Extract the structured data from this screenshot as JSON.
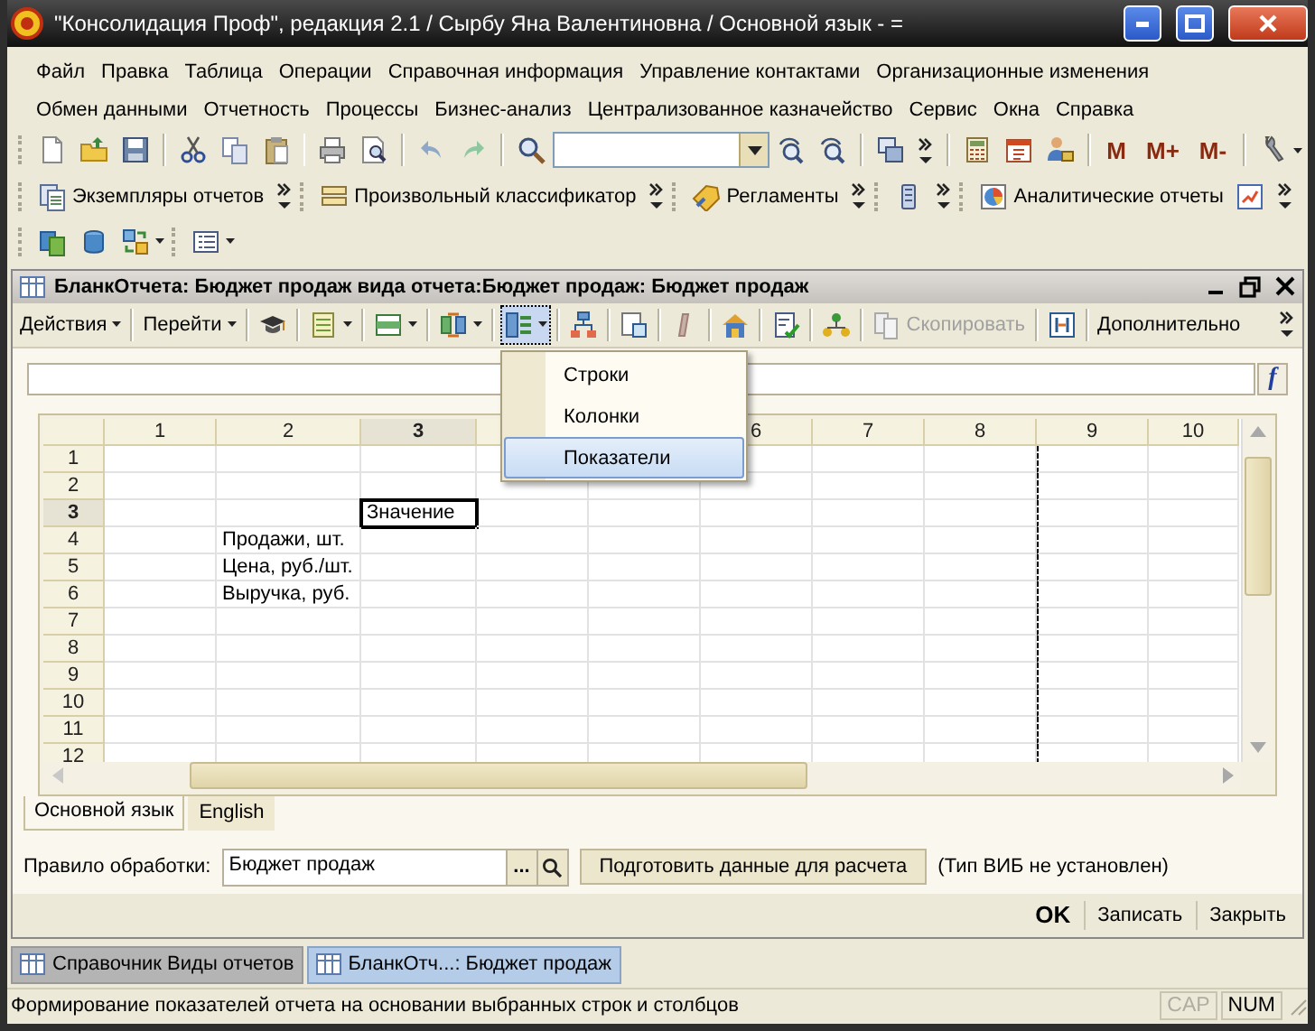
{
  "window": {
    "title": "\"Консолидация Проф\", редакция 2.1 / Сырбу Яна Валентиновна / Основной язык - ="
  },
  "menu_rows": [
    [
      "Файл",
      "Правка",
      "Таблица",
      "Операции",
      "Справочная информация",
      "Управление контактами",
      "Организационные изменения"
    ],
    [
      "Обмен данными",
      "Отчетность",
      "Процессы",
      "Бизнес-анализ",
      "Централизованное казначейство",
      "Сервис",
      "Окна",
      "Справка"
    ]
  ],
  "toolbar_1": {
    "memory_buttons": [
      "M",
      "M+",
      "M-"
    ]
  },
  "toolbar_2": {
    "buttons": [
      "Экземпляры отчетов",
      "Произвольный классификатор",
      "Регламенты",
      "Аналитические отчеты"
    ]
  },
  "document_window": {
    "title": "БланкОтчета: Бюджет продаж вида отчета:Бюджет продаж: Бюджет продаж",
    "toolbar": {
      "actions_menu": "Действия",
      "go_menu": "Перейти",
      "copy_button": {
        "label": "Скопировать",
        "disabled": true
      },
      "more_button": "Дополнительно"
    },
    "dropdown": {
      "open": true,
      "items": [
        {
          "label": "Строки",
          "selected": false
        },
        {
          "label": "Колонки",
          "selected": false
        },
        {
          "label": "Показатели",
          "selected": true
        }
      ]
    },
    "formula_button": "f",
    "table": {
      "columns": [
        {
          "label": "1",
          "selected": false
        },
        {
          "label": "2",
          "selected": false
        },
        {
          "label": "3",
          "selected": true
        },
        {},
        {},
        {
          "label": "6",
          "selected": false
        },
        {
          "label": "7",
          "selected": false
        },
        {
          "label": "8",
          "selected": false
        },
        {
          "label": "9",
          "selected": false
        },
        {
          "label": "10",
          "selected": false
        }
      ],
      "rows": [
        {
          "label": "1",
          "selected": false
        },
        {
          "label": "2",
          "selected": false
        },
        {
          "label": "3",
          "selected": true,
          "column_3": "Значение"
        },
        {
          "label": "4",
          "selected": false,
          "column_2": "Продажи, шт."
        },
        {
          "label": "5",
          "selected": false,
          "column_2": "Цена, руб./шт."
        },
        {
          "label": "6",
          "selected": false,
          "column_2": "Выручка, руб."
        },
        {
          "label": "7",
          "selected": false
        },
        {
          "label": "8",
          "selected": false
        },
        {
          "label": "9",
          "selected": false
        },
        {
          "label": "10",
          "selected": false
        },
        {
          "label": "11",
          "selected": false
        },
        {
          "label": "12",
          "selected": false
        }
      ]
    },
    "language_tabs": [
      {
        "label": "Основной язык",
        "selected": true
      },
      {
        "label": "English",
        "selected": false
      }
    ],
    "processing_rule": {
      "label": "Правило обработки:",
      "value": "Бюджет продаж",
      "browse_button": "...",
      "prepare_button": "Подготовить данные для расчета",
      "note": "(Тип ВИБ не установлен)"
    },
    "buttons": [
      {
        "label": "OK",
        "default": true
      },
      {
        "label": "Записать",
        "default": false
      },
      {
        "label": "Закрыть",
        "default": false
      }
    ]
  },
  "taskbar": [
    {
      "label": "Справочник Виды отчетов",
      "selected": false
    },
    {
      "label": "БланкОтч...: Бюджет продаж",
      "selected": true
    }
  ],
  "status_bar": {
    "text": "Формирование показателей отчета на основании выбранных строк и столбцов",
    "indicators": [
      {
        "label": "CAP",
        "disabled": true
      },
      {
        "label": "NUM",
        "disabled": false
      }
    ]
  }
}
